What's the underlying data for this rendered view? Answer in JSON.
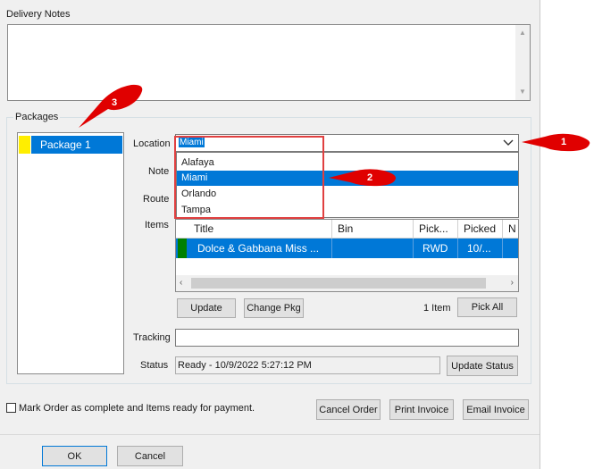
{
  "delivery_notes": {
    "label": "Delivery Notes",
    "value": ""
  },
  "packages": {
    "label": "Packages",
    "items": [
      {
        "label": "Package 1",
        "selected": true
      }
    ]
  },
  "location": {
    "label": "Location",
    "selected": "Miami",
    "options": [
      "Alafaya",
      "Miami",
      "Orlando",
      "Tampa"
    ],
    "highlighted_index": 1
  },
  "note_label": "Note",
  "route_label": "Route",
  "items_grid": {
    "label": "Items",
    "columns": [
      "Title",
      "Bin",
      "Pick...",
      "Picked",
      "N"
    ],
    "rows": [
      {
        "title": "Dolce & Gabbana Miss ...",
        "bin": "",
        "pick": "RWD",
        "picked": "10/...",
        "status_color": "#008000"
      }
    ]
  },
  "buttons": {
    "update": "Update",
    "change_pkg": "Change Pkg",
    "item_count": "1 Item",
    "pick_all": "Pick All",
    "update_status": "Update Status",
    "cancel_order": "Cancel Order",
    "print_invoice": "Print Invoice",
    "email_invoice": "Email Invoice",
    "ok": "OK",
    "cancel": "Cancel"
  },
  "tracking": {
    "label": "Tracking",
    "value": ""
  },
  "status": {
    "label": "Status",
    "value": "Ready - 10/9/2022 5:27:12 PM"
  },
  "mark_complete": {
    "label": "Mark Order as complete and Items ready for payment.",
    "checked": false
  },
  "callouts": [
    "1",
    "2",
    "3"
  ],
  "colors": {
    "selection": "#0078d7",
    "callout": "#e00000",
    "highlight_box": "#e04040"
  }
}
